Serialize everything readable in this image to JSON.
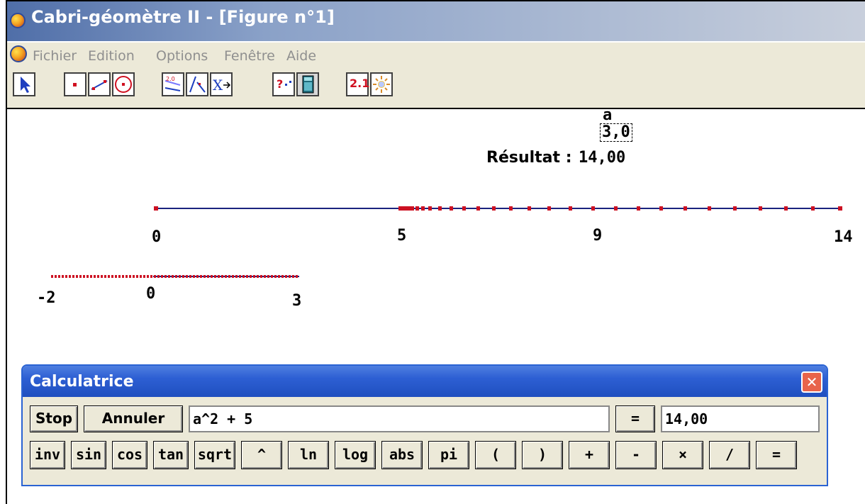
{
  "window": {
    "title": "Cabri-géomètre II - [Figure n°1]"
  },
  "menu": {
    "items": [
      "Fichier",
      "Edition",
      "Options",
      "Fenêtre",
      "Aide"
    ]
  },
  "toolbar": {
    "tools": [
      {
        "name": "pointer-tool-button",
        "icon": "pointer-arrow-icon"
      },
      {
        "name": "point-tool-button",
        "icon": "point-icon"
      },
      {
        "name": "line-tool-button",
        "icon": "line-icon"
      },
      {
        "name": "circle-tool-button",
        "icon": "circle-icon"
      },
      {
        "name": "construct-tool-button",
        "icon": "construct-icon"
      },
      {
        "name": "transform-tool-button",
        "icon": "transform-icon"
      },
      {
        "name": "macro-tool-button",
        "icon": "macro-icon"
      },
      {
        "name": "check-property-tool-button",
        "icon": "check-property-icon"
      },
      {
        "name": "calculator-tool-button",
        "icon": "calculator-icon"
      },
      {
        "name": "measure-tool-button",
        "icon": "measure-icon",
        "label": "2.1"
      },
      {
        "name": "display-tool-button",
        "icon": "display-icon"
      }
    ]
  },
  "canvas": {
    "variable": {
      "name": "a",
      "value": "3,0"
    },
    "result": {
      "label": "Résultat :",
      "value": "14,00"
    },
    "axis1_labels": [
      "0",
      "5",
      "9",
      "14"
    ],
    "axis2_labels": [
      "-2",
      "0",
      "3"
    ]
  },
  "calculator": {
    "title": "Calculatrice",
    "stop_label": "Stop",
    "cancel_label": "Annuler",
    "expression": "a^2 + 5",
    "equals_label": "=",
    "result": "14,00",
    "keys": [
      "inv",
      "sin",
      "cos",
      "tan",
      "sqrt",
      "^",
      "ln",
      "log",
      "abs",
      "pi",
      "(",
      ")",
      "+",
      "-",
      "×",
      "/",
      "="
    ]
  }
}
